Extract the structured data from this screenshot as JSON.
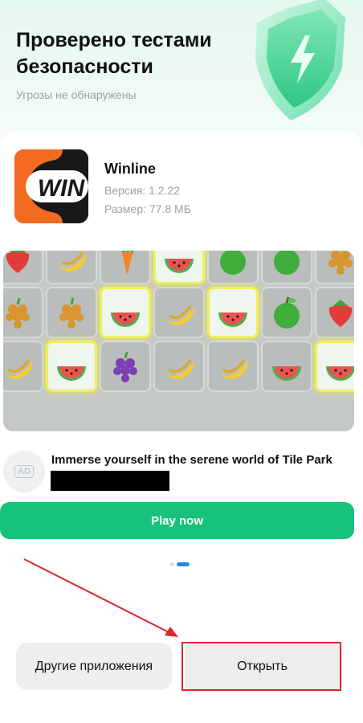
{
  "header": {
    "title": "Проверено тестами безопасности",
    "subtitle": "Угрозы не обнаружены"
  },
  "app": {
    "name": "Winline",
    "version": "Версия: 1.2.22",
    "size": "Размер: 77.8 МБ",
    "icon_text": "WIN",
    "icon_colors": {
      "orange": "#f26b21",
      "dark": "#18181a"
    }
  },
  "banner": {
    "tiles": [
      [
        "strawberry",
        "banana",
        "carrot",
        "watermelon",
        "green-apple",
        "green-apple",
        "grapes"
      ],
      [
        "grapes",
        "grapes",
        "watermelon",
        "banana",
        "watermelon",
        "green-apple",
        "strawberry"
      ],
      [
        "banana",
        "watermelon",
        "purple-grapes",
        "banana",
        "banana",
        "watermelon",
        "watermelon"
      ]
    ],
    "highlighted": [
      "0-3",
      "1-2",
      "1-4",
      "2-1",
      "2-6"
    ]
  },
  "ad": {
    "badge": "AD",
    "title": "Immerse yourself in the serene world of Tile Park",
    "cta": "Play now"
  },
  "pager": {
    "count": 2,
    "active": 1
  },
  "actions": {
    "other_apps": "Другие приложения",
    "open": "Открыть"
  },
  "colors": {
    "accent_green": "#16c27a",
    "pager_active": "#2b86e0",
    "annotation_red": "#e0242a"
  }
}
